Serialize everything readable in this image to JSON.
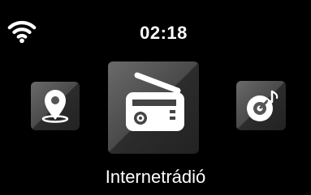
{
  "status": {
    "wifi_icon": "wifi-icon",
    "time": "02:18"
  },
  "menu": {
    "items": [
      {
        "icon": "location-pin-icon"
      },
      {
        "icon": "radio-icon",
        "label": "Internetrádió",
        "selected": true
      },
      {
        "icon": "music-disc-icon"
      }
    ],
    "selected_label": "Internetrádió"
  },
  "colors": {
    "background": "#000000",
    "tile_light": "#6a6a6a",
    "tile_dark": "#222222",
    "icon": "#ffffff"
  }
}
